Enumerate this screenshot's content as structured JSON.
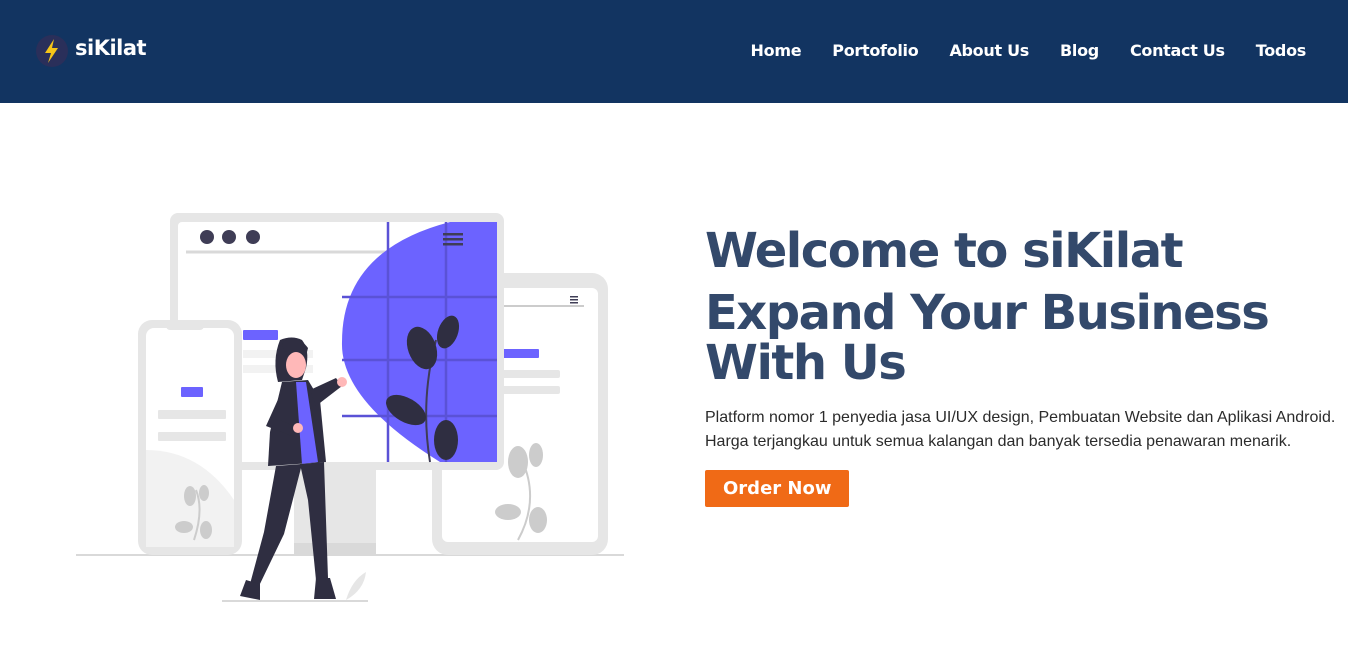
{
  "brand": {
    "name": "siKilat",
    "icon": "lightning-bolt-icon"
  },
  "nav": {
    "items": [
      {
        "label": "Home"
      },
      {
        "label": "Portofolio"
      },
      {
        "label": "About Us"
      },
      {
        "label": "Blog"
      },
      {
        "label": "Contact Us"
      },
      {
        "label": "Todos"
      }
    ]
  },
  "hero": {
    "title": "Welcome to siKilat",
    "subtitle_line1": "Expand Your Business",
    "subtitle_line2": "With Us",
    "description": "Platform nomor 1 penyedia jasa UI/UX design, Pembuatan Website dan Aplikasi Android. Harga terjangkau untuk semua kalangan dan banyak tersedia penawaran menarik.",
    "cta_label": "Order Now"
  },
  "colors": {
    "navbar": "#123461",
    "heading": "#33496b",
    "accent": "#6c63ff",
    "cta": "#f06a16"
  }
}
